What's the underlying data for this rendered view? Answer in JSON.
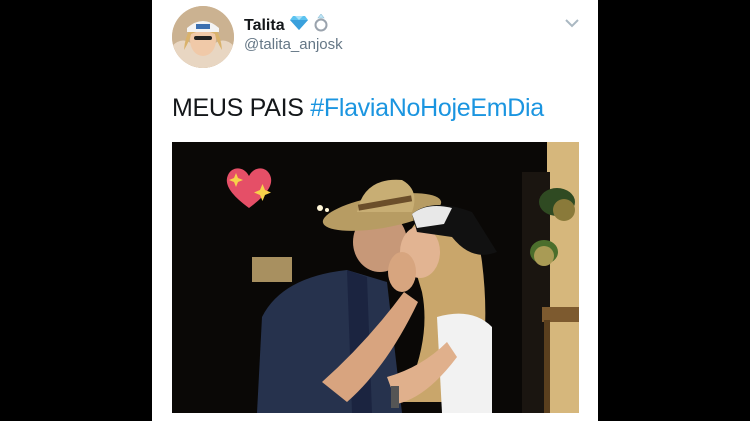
{
  "tweet": {
    "author_name": "Talita",
    "author_handle": "@talita_anjosk",
    "badges": [
      "gem-icon",
      "ring-icon"
    ],
    "text_plain": "MEUS PAIS",
    "hashtag": "#FlaviaNoHojeEmDia",
    "hashtag_color": "#1b95e0"
  },
  "photo": {
    "sticker": "sparkling-heart-icon"
  }
}
